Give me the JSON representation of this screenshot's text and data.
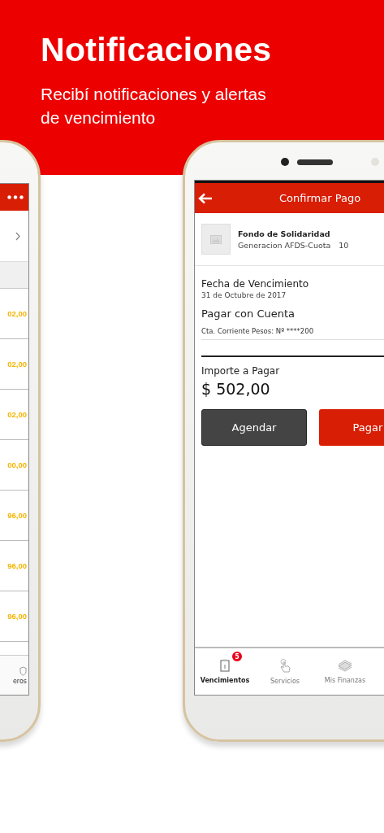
{
  "banner": {
    "title": "Notificaciones",
    "subtitle": "Recibí notificaciones y alertas de vencimiento"
  },
  "left_phone": {
    "rows": [
      {
        "amount": "02,00"
      },
      {
        "amount": "02,00"
      },
      {
        "amount": "02,00"
      },
      {
        "amount": "00,00"
      },
      {
        "amount": "96,00"
      },
      {
        "amount": "96,00"
      },
      {
        "amount": "96,00"
      }
    ],
    "nav_label": "eros"
  },
  "right_phone": {
    "header": {
      "title": "Confirmar Pago"
    },
    "item": {
      "title": "Fondo de Solidaridad",
      "subtitle": "Generacion AFDS-Cuota",
      "number": "10"
    },
    "due_label": "Fecha de Vencimiento",
    "due_date": "31 de Octubre de 2017",
    "account_label": "Pagar con Cuenta",
    "account": "Cta. Corriente Pesos: Nº ****200",
    "amount_label": "Importe a Pagar",
    "amount": "$ 502,00",
    "buttons": [
      {
        "label": "Agendar",
        "kind": "secondary"
      },
      {
        "label": "Pagar",
        "kind": "primary"
      }
    ],
    "nav": [
      {
        "label": "Vencimientos",
        "selected": true,
        "badge": "5",
        "kind": "document"
      },
      {
        "label": "Servicios",
        "selected": false,
        "kind": "hand"
      },
      {
        "label": "Mis Finanzas",
        "selected": false,
        "kind": "money"
      }
    ]
  }
}
